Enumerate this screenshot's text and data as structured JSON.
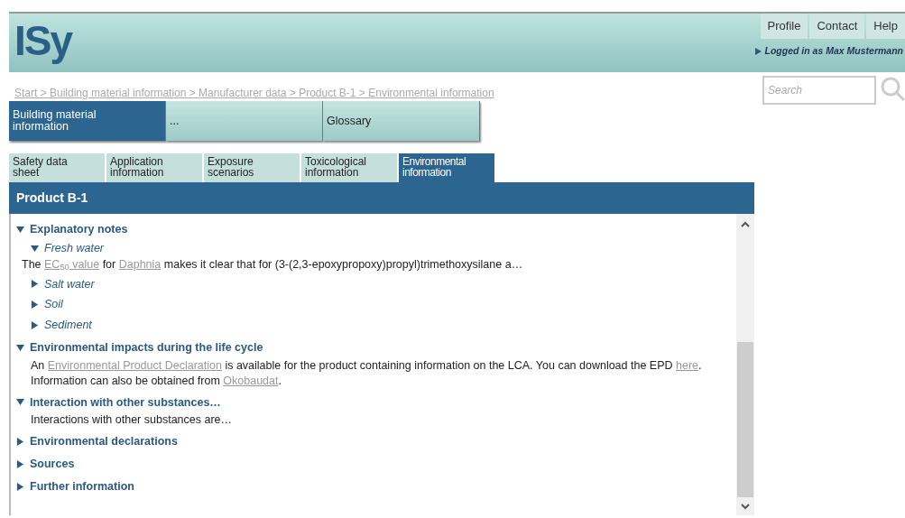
{
  "logo": "ISy",
  "top_links": [
    {
      "label": "Profile"
    },
    {
      "label": "Contact"
    },
    {
      "label": "Help"
    }
  ],
  "logged_in": "Logged in as Max Mustermann",
  "breadcrumb": "Start > Building material information > Manufacturer data > Product B-1 > Environmental information",
  "search": {
    "placeholder": "Search"
  },
  "main_nav": [
    {
      "label": "Building material information",
      "selected": true
    },
    {
      "label": "...",
      "selected": false
    },
    {
      "label": "Glossary",
      "selected": false
    }
  ],
  "sub_tabs": [
    {
      "label": "Safety data sheet",
      "selected": false
    },
    {
      "label": "Application information",
      "selected": false
    },
    {
      "label": "Exposure scenarios",
      "selected": false
    },
    {
      "label": "Toxicological information",
      "selected": false
    },
    {
      "label": "Environmental information",
      "selected": true
    }
  ],
  "panel_title": "Product B-1",
  "sections": [
    {
      "title": "Explanatory notes",
      "expanded": true,
      "children": [
        {
          "title": "Fresh water",
          "expanded": true,
          "body": [
            {
              "text": "The ",
              "kind": "text"
            },
            {
              "text": "EC$_{50}$ value",
              "kind": "link"
            },
            {
              "text": " for ",
              "kind": "text"
            },
            {
              "text": "Daphnia",
              "kind": "link"
            },
            {
              "text": " makes it clear that for (3-(2,3-epoxypropoxy)propyl)trimethoxysilane a…",
              "kind": "text"
            }
          ]
        },
        {
          "title": "Salt water",
          "expanded": false
        },
        {
          "title": "Soil",
          "expanded": false
        },
        {
          "title": "Sediment",
          "expanded": false
        }
      ]
    },
    {
      "title": "Environmental impacts during the life cycle",
      "expanded": true,
      "body": [
        {
          "text": "An ",
          "kind": "text"
        },
        {
          "text": "Environmental Product Declaration",
          "kind": "link"
        },
        {
          "text": " is available for the product containing information on the LCA. You can download the EPD ",
          "kind": "text"
        },
        {
          "text": "here",
          "kind": "link"
        },
        {
          "text": ". Information can also be obtained from ",
          "kind": "text"
        },
        {
          "text": "Okobaudat",
          "kind": "link"
        },
        {
          "text": ".",
          "kind": "text"
        }
      ]
    },
    {
      "title": "Interaction with other substances…",
      "expanded": true,
      "body": [
        {
          "text": "Interactions with other substances are…",
          "kind": "text"
        }
      ]
    },
    {
      "title": "Environmental declarations",
      "expanded": false
    },
    {
      "title": "Sources",
      "expanded": false
    },
    {
      "title": "Further information",
      "expanded": false
    }
  ]
}
